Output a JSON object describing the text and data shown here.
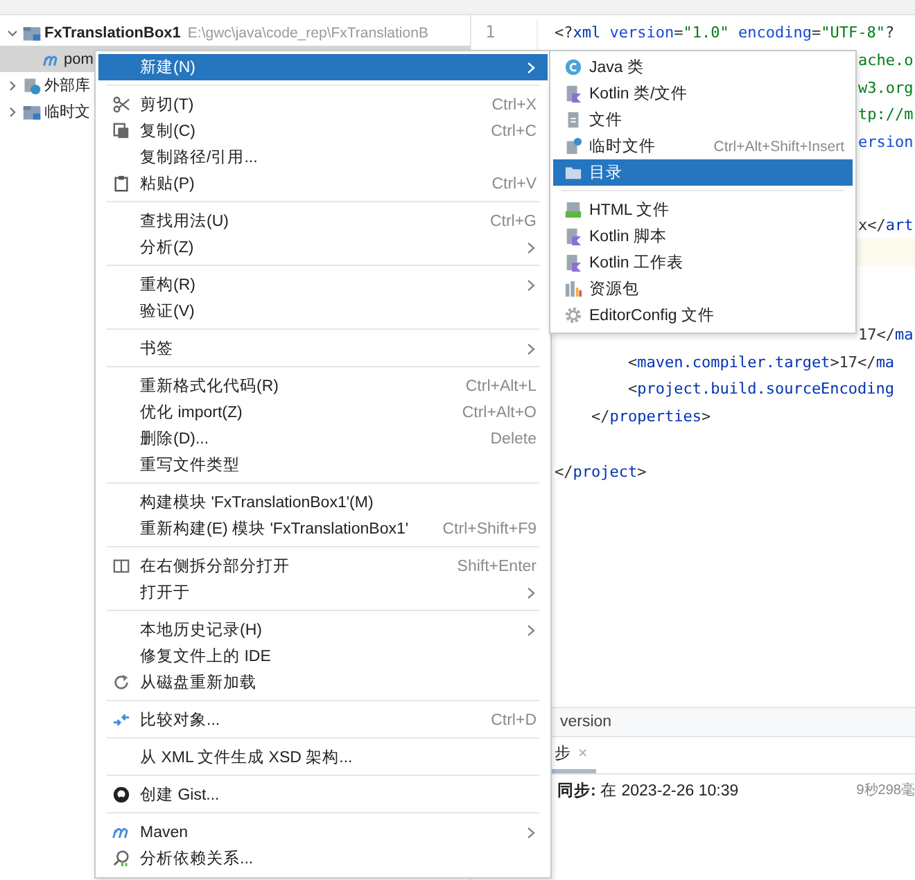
{
  "project_tree": [
    {
      "label": "FxTranslationBox1",
      "path": "E:\\gwc\\java\\code_rep\\FxTranslationB",
      "expanded": true,
      "selected": false,
      "children": [
        {
          "label": "pom",
          "selected": true
        }
      ]
    },
    {
      "label": "外部库",
      "expanded": false,
      "selected": false
    },
    {
      "label": "临时文",
      "expanded": false,
      "selected": false
    }
  ],
  "editor": {
    "line_numbers": [
      "1"
    ],
    "lines": [
      {
        "kind": "code",
        "tokens": [
          {
            "kind": "punct",
            "text": "<?"
          },
          {
            "kind": "tag",
            "text": "xml"
          },
          {
            "kind": "attr",
            "text": " version"
          },
          {
            "kind": "punct",
            "text": "="
          },
          {
            "kind": "string",
            "text": "\"1.0\""
          },
          {
            "kind": "attr",
            "text": " encoding"
          },
          {
            "kind": "punct",
            "text": "="
          },
          {
            "kind": "string",
            "text": "\"UTF-8\""
          },
          {
            "kind": "punct",
            "text": "?"
          }
        ]
      },
      {
        "kind": "fragment",
        "tokens": [
          {
            "kind": "string",
            "text": "ache.o"
          }
        ]
      },
      {
        "kind": "fragment",
        "tokens": [
          {
            "kind": "string",
            "text": "w3.org"
          }
        ]
      },
      {
        "kind": "fragment",
        "tokens": [
          {
            "kind": "string",
            "text": "tp://m"
          }
        ]
      },
      {
        "kind": "fragment",
        "tokens": [
          {
            "kind": "attr",
            "text": "ersion"
          }
        ]
      },
      {
        "kind": "blank"
      },
      {
        "kind": "blank"
      },
      {
        "kind": "fragment",
        "tokens": [
          {
            "kind": "punct",
            "text": "x</"
          },
          {
            "kind": "tag",
            "text": "art"
          }
        ]
      },
      {
        "kind": "current"
      },
      {
        "kind": "blank"
      },
      {
        "kind": "blank"
      },
      {
        "kind": "fragment",
        "tokens": [
          {
            "kind": "punct",
            "text": "17</"
          },
          {
            "kind": "tag",
            "text": "ma"
          }
        ]
      },
      {
        "kind": "code",
        "tokens": [
          {
            "kind": "punct",
            "text": "        <"
          },
          {
            "kind": "tag",
            "text": "maven.compiler.target"
          },
          {
            "kind": "punct",
            "text": ">17</"
          },
          {
            "kind": "tag",
            "text": "ma"
          }
        ]
      },
      {
        "kind": "code",
        "tokens": [
          {
            "kind": "punct",
            "text": "        <"
          },
          {
            "kind": "tag",
            "text": "project.build.sourceEncoding"
          }
        ]
      },
      {
        "kind": "code",
        "tokens": [
          {
            "kind": "punct",
            "text": "    </"
          },
          {
            "kind": "tag",
            "text": "properties"
          },
          {
            "kind": "punct",
            "text": ">"
          }
        ]
      },
      {
        "kind": "blank"
      },
      {
        "kind": "code",
        "tokens": [
          {
            "kind": "punct",
            "text": "</"
          },
          {
            "kind": "tag",
            "text": "project"
          },
          {
            "kind": "punct",
            "text": ">"
          }
        ]
      }
    ],
    "breadcrumb": "version"
  },
  "tool_window": {
    "tab": "步",
    "close": "×",
    "sync_label": "同步:",
    "sync_text": "在 2023-2-26 10:39",
    "duration": "9秒298毫"
  },
  "context_menu": [
    [
      {
        "label": "新建(N)",
        "submenu": true,
        "selected": true
      }
    ],
    [
      {
        "label": "剪切(T)",
        "shortcut": "Ctrl+X",
        "submenu": false,
        "selected": false
      },
      {
        "label": "复制(C)",
        "shortcut": "Ctrl+C",
        "submenu": false,
        "selected": false
      },
      {
        "label": "复制路径/引用...",
        "submenu": false,
        "selected": false
      },
      {
        "label": "粘贴(P)",
        "shortcut": "Ctrl+V",
        "submenu": false,
        "selected": false
      }
    ],
    [
      {
        "label": "查找用法(U)",
        "shortcut": "Ctrl+G",
        "submenu": false,
        "selected": false
      },
      {
        "label": "分析(Z)",
        "submenu": true,
        "selected": false
      }
    ],
    [
      {
        "label": "重构(R)",
        "submenu": true,
        "selected": false
      },
      {
        "label": "验证(V)",
        "submenu": false,
        "selected": false
      }
    ],
    [
      {
        "label": "书签",
        "submenu": true,
        "selected": false
      }
    ],
    [
      {
        "label": "重新格式化代码(R)",
        "shortcut": "Ctrl+Alt+L",
        "submenu": false,
        "selected": false
      },
      {
        "label": "优化 import(Z)",
        "shortcut": "Ctrl+Alt+O",
        "submenu": false,
        "selected": false
      },
      {
        "label": "删除(D)...",
        "shortcut": "Delete",
        "submenu": false,
        "selected": false
      },
      {
        "label": "重写文件类型",
        "submenu": false,
        "selected": false
      }
    ],
    [
      {
        "label": "构建模块 'FxTranslationBox1'(M)",
        "submenu": false,
        "selected": false
      },
      {
        "label": "重新构建(E) 模块 'FxTranslationBox1'",
        "shortcut": "Ctrl+Shift+F9",
        "submenu": false,
        "selected": false
      }
    ],
    [
      {
        "label": "在右侧拆分部分打开",
        "shortcut": "Shift+Enter",
        "submenu": false,
        "selected": false
      },
      {
        "label": "打开于",
        "submenu": true,
        "selected": false
      }
    ],
    [
      {
        "label": "本地历史记录(H)",
        "submenu": true,
        "selected": false
      },
      {
        "label": "修复文件上的 IDE",
        "submenu": false,
        "selected": false
      },
      {
        "label": "从磁盘重新加载",
        "submenu": false,
        "selected": false
      }
    ],
    [
      {
        "label": "比较对象...",
        "shortcut": "Ctrl+D",
        "submenu": false,
        "selected": false
      }
    ],
    [
      {
        "label": "从 XML 文件生成 XSD 架构...",
        "submenu": false,
        "selected": false
      }
    ],
    [
      {
        "label": "创建 Gist...",
        "submenu": false,
        "selected": false
      }
    ],
    [
      {
        "label": "Maven",
        "submenu": true,
        "selected": false
      },
      {
        "label": "分析依赖关系...",
        "submenu": false,
        "selected": false
      }
    ]
  ],
  "submenu": [
    [
      {
        "label": "Java 类",
        "selected": false
      },
      {
        "label": "Kotlin 类/文件",
        "selected": false
      },
      {
        "label": "文件",
        "selected": false
      },
      {
        "label": "临时文件",
        "shortcut": "Ctrl+Alt+Shift+Insert",
        "selected": false
      },
      {
        "label": "目录",
        "selected": true
      }
    ],
    [
      {
        "label": "HTML 文件",
        "selected": false
      },
      {
        "label": "Kotlin 脚本",
        "selected": false
      },
      {
        "label": "Kotlin 工作表",
        "selected": false
      },
      {
        "label": "资源包",
        "selected": false
      },
      {
        "label": "EditorConfig 文件",
        "selected": false
      }
    ]
  ]
}
